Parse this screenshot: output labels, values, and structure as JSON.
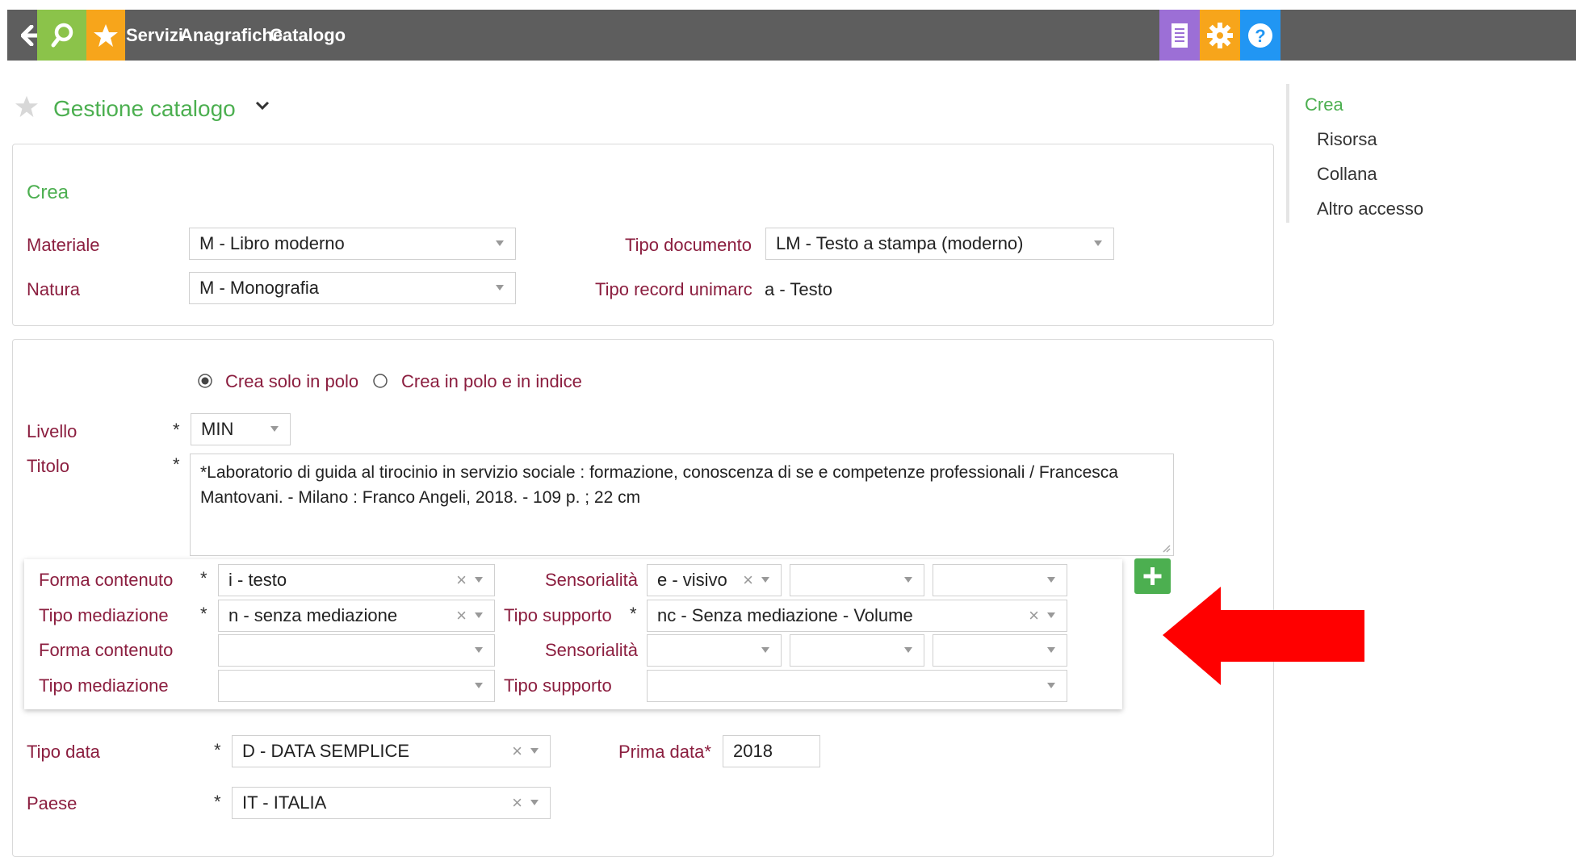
{
  "topbar": {
    "nav": [
      "Servizi",
      "Anagrafiche",
      "Catalogo"
    ],
    "icons": [
      "back-arrow-icon",
      "search-icon",
      "favorite-star-icon",
      "document-icon",
      "gear-icon",
      "help-icon"
    ],
    "colors": {
      "bar": "#5e5e5e",
      "back": "#5e5e5e",
      "search": "#8bc34a",
      "star": "#f7a51b",
      "doc": "#9c6fd6",
      "gear": "#f7a51b",
      "help": "#2196f3"
    }
  },
  "page": {
    "title": "Gestione catalogo"
  },
  "crea_panel": {
    "heading": "Crea",
    "materiale_label": "Materiale",
    "materiale_value": "M - Libro moderno",
    "natura_label": "Natura",
    "natura_value": "M - Monografia",
    "tipo_documento_label": "Tipo documento",
    "tipo_documento_value": "LM - Testo a stampa (moderno)",
    "tipo_record_label": "Tipo record unimarc",
    "tipo_record_value": "a - Testo"
  },
  "form": {
    "radio_polo": "Crea solo in polo",
    "radio_indice": "Crea in polo e in indice",
    "livello_label": "Livello",
    "livello_value": "MIN",
    "titolo_label": "Titolo",
    "titolo_value": "*Laboratorio di guida al tirocinio in servizio sociale : formazione, conoscenza di se e competenze professionali / Francesca Mantovani. - Milano : Franco Angeli, 2018. - 109 p. ; 22 cm",
    "required_mark": "*",
    "rows": [
      {
        "forma_label": "Forma contenuto",
        "forma_value": "i - testo",
        "sens_label": "Sensorialità",
        "sens_value": "e - visivo"
      },
      {
        "med_label": "Tipo mediazione",
        "med_value": "n - senza mediazione",
        "supp_label": "Tipo supporto",
        "supp_value": "nc - Senza mediazione - Volume"
      },
      {
        "forma_label": "Forma contenuto",
        "sens_label": "Sensorialità"
      },
      {
        "med_label": "Tipo mediazione",
        "supp_label": "Tipo supporto"
      }
    ],
    "tipo_data_label": "Tipo data",
    "tipo_data_value": "D - DATA SEMPLICE",
    "prima_data_label": "Prima data*",
    "prima_data_value": "2018",
    "paese_label": "Paese",
    "paese_value": "IT - ITALIA"
  },
  "sidebar": {
    "heading": "Crea",
    "items": [
      "Risorsa",
      "Collana",
      "Altro accesso"
    ]
  },
  "annotation": {
    "arrow_color": "#ff0000"
  }
}
